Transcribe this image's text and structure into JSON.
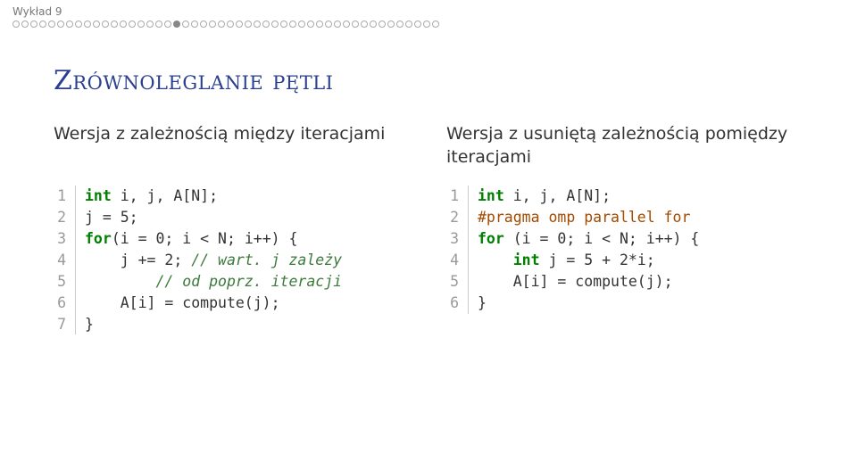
{
  "header": {
    "section": "Wykład 9",
    "progress_total": 48,
    "progress_current_index": 18
  },
  "title": "Zrównoleglanie pętli",
  "left": {
    "desc": "Wersja z zależnością między iteracjami",
    "code": [
      {
        "n": "1",
        "tokens": [
          {
            "cls": "kw",
            "t": "int"
          },
          {
            "cls": "",
            "t": " i, j, A[N];"
          }
        ]
      },
      {
        "n": "2",
        "tokens": [
          {
            "cls": "",
            "t": "j = 5;"
          }
        ]
      },
      {
        "n": "3",
        "tokens": [
          {
            "cls": "flw",
            "t": "for"
          },
          {
            "cls": "",
            "t": "(i = 0; i < N; i++) {"
          }
        ]
      },
      {
        "n": "4",
        "tokens": [
          {
            "cls": "",
            "t": "    j += 2; "
          },
          {
            "cls": "cm",
            "t": "// wart. j zależy"
          }
        ]
      },
      {
        "n": "5",
        "tokens": [
          {
            "cls": "",
            "t": "        "
          },
          {
            "cls": "cm",
            "t": "// od poprz. iteracji"
          }
        ]
      },
      {
        "n": "6",
        "tokens": [
          {
            "cls": "",
            "t": "    A[i] = compute(j);"
          }
        ]
      },
      {
        "n": "7",
        "tokens": [
          {
            "cls": "",
            "t": "}"
          }
        ]
      }
    ]
  },
  "right": {
    "desc": "Wersja z usuniętą zależnością pomiędzy iteracjami",
    "code": [
      {
        "n": "1",
        "tokens": [
          {
            "cls": "kw",
            "t": "int"
          },
          {
            "cls": "",
            "t": " i, j, A[N];"
          }
        ]
      },
      {
        "n": "2",
        "tokens": [
          {
            "cls": "ppk",
            "t": "#pragma omp parallel for"
          }
        ]
      },
      {
        "n": "3",
        "tokens": [
          {
            "cls": "flw",
            "t": "for"
          },
          {
            "cls": "",
            "t": " (i = 0; i < N; i++) {"
          }
        ]
      },
      {
        "n": "4",
        "tokens": [
          {
            "cls": "",
            "t": "    "
          },
          {
            "cls": "kw",
            "t": "int"
          },
          {
            "cls": "",
            "t": " j = 5 + 2*i;"
          }
        ]
      },
      {
        "n": "5",
        "tokens": [
          {
            "cls": "",
            "t": "    A[i] = compute(j);"
          }
        ]
      },
      {
        "n": "6",
        "tokens": [
          {
            "cls": "",
            "t": "}"
          }
        ]
      }
    ]
  }
}
